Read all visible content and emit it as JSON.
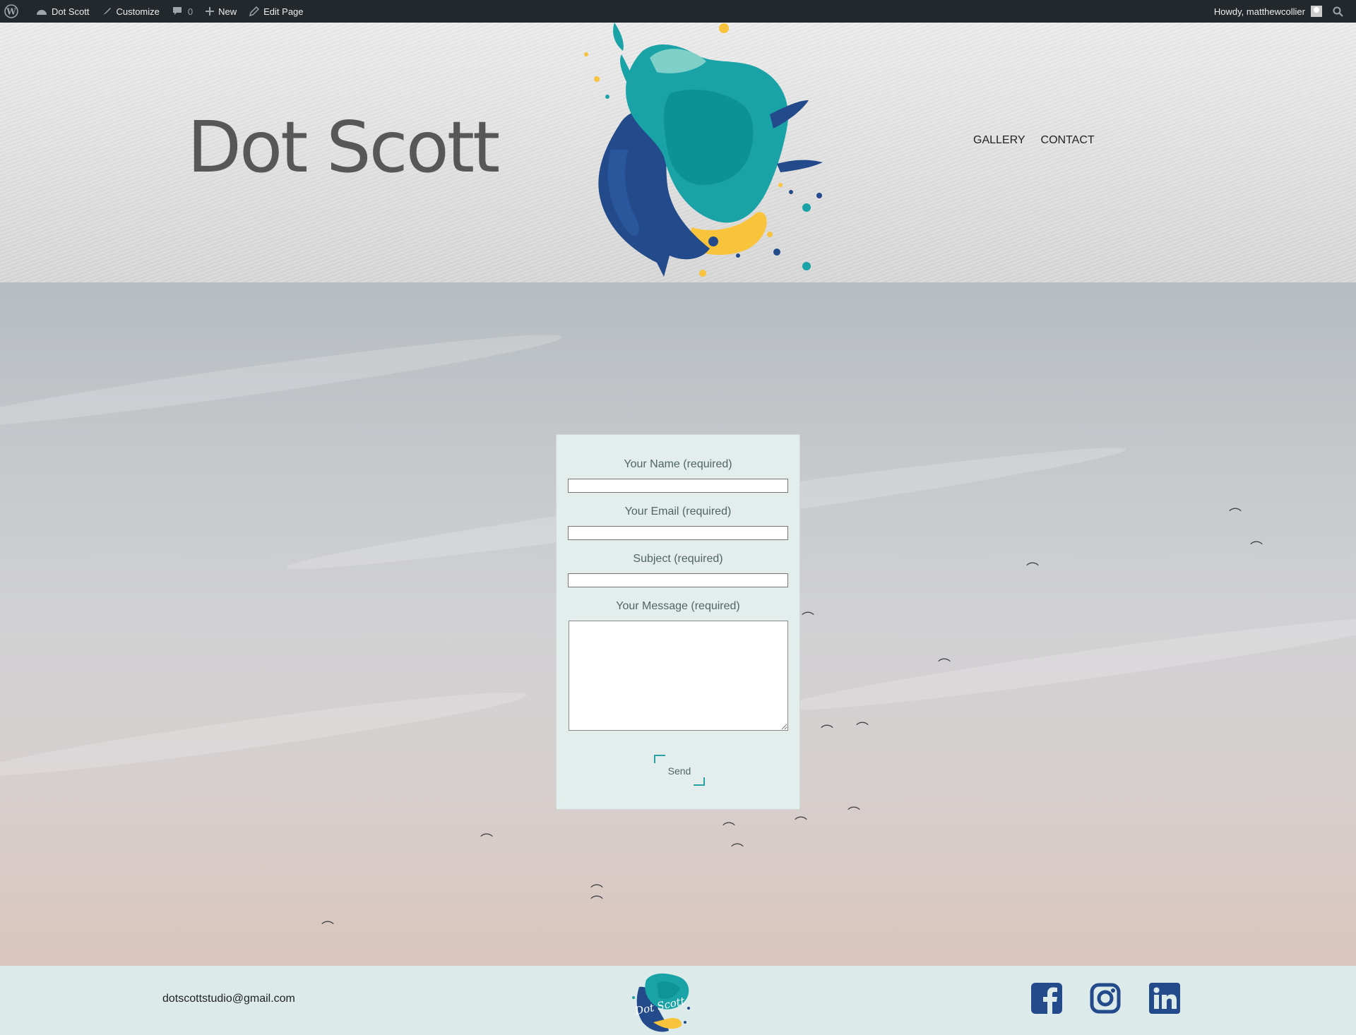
{
  "adminbar": {
    "site_name": "Dot Scott",
    "customize": "Customize",
    "comments_count": "0",
    "new": "New",
    "edit_page": "Edit Page",
    "howdy": "Howdy, matthewcollier"
  },
  "header": {
    "site_title": "Dot Scott",
    "nav": [
      "GALLERY",
      "CONTACT"
    ]
  },
  "form": {
    "name_label": "Your Name (required)",
    "email_label": "Your Email (required)",
    "subject_label": "Subject (required)",
    "message_label": "Your Message (required)",
    "name_value": "",
    "email_value": "",
    "subject_value": "",
    "message_value": "",
    "send_label": "Send"
  },
  "footer": {
    "email": "dotscottstudio@gmail.com",
    "logo_text": "Dot Scott",
    "social": [
      "facebook-icon",
      "instagram-icon",
      "linkedin-icon"
    ]
  },
  "colors": {
    "adminbar": "#23282d",
    "accent_teal": "#2aa1a3",
    "brand_navy": "#1f4b87",
    "brand_yellow": "#f8c43c",
    "form_bg": "#e3eeec",
    "footer_bg": "#dcebea"
  }
}
